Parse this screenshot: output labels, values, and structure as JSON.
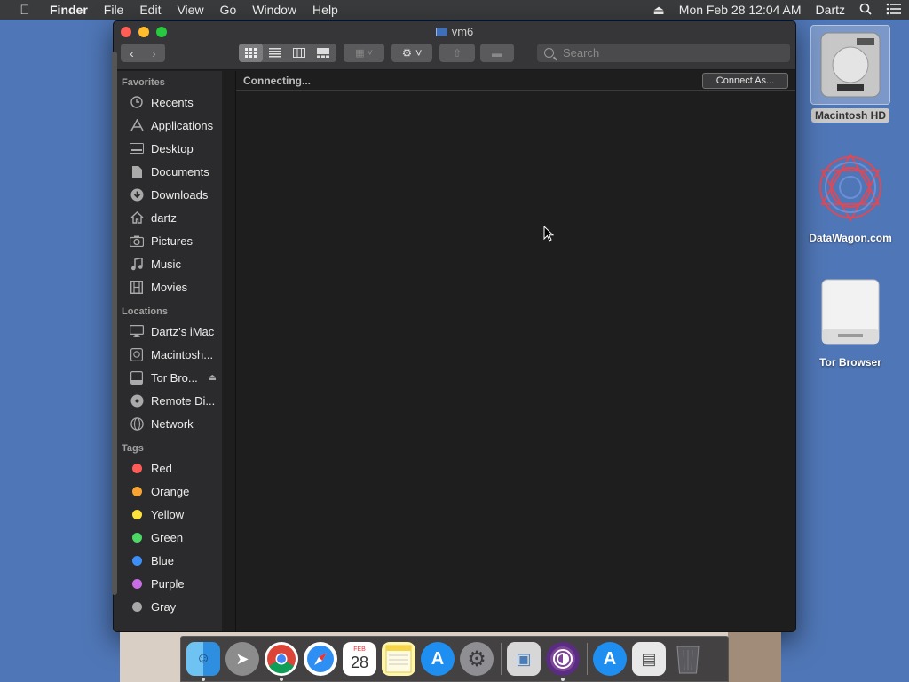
{
  "menubar": {
    "app": "Finder",
    "items": [
      "File",
      "Edit",
      "View",
      "Go",
      "Window",
      "Help"
    ],
    "clock": "Mon Feb 28  12:04 AM",
    "user": "Dartz"
  },
  "window": {
    "title": "vm6",
    "search_placeholder": "Search",
    "status": "Connecting...",
    "connect_button": "Connect As..."
  },
  "sidebar": {
    "favorites_header": "Favorites",
    "favorites": [
      {
        "label": "Recents",
        "icon": "clock-icon"
      },
      {
        "label": "Applications",
        "icon": "applications-icon"
      },
      {
        "label": "Desktop",
        "icon": "desktop-icon"
      },
      {
        "label": "Documents",
        "icon": "document-icon"
      },
      {
        "label": "Downloads",
        "icon": "download-icon"
      },
      {
        "label": "dartz",
        "icon": "home-icon"
      },
      {
        "label": "Pictures",
        "icon": "camera-icon"
      },
      {
        "label": "Music",
        "icon": "music-note-icon"
      },
      {
        "label": "Movies",
        "icon": "film-icon"
      }
    ],
    "locations_header": "Locations",
    "locations": [
      {
        "label": "Dartz’s iMac",
        "icon": "imac-icon"
      },
      {
        "label": "Macintosh...",
        "icon": "hard-disk-icon"
      },
      {
        "label": "Tor Bro...",
        "icon": "external-disk-icon"
      },
      {
        "label": "Remote Di...",
        "icon": "optical-disc-icon"
      },
      {
        "label": "Network",
        "icon": "globe-icon"
      }
    ],
    "tags_header": "Tags",
    "tags": [
      {
        "label": "Red",
        "color": "#ff5b57"
      },
      {
        "label": "Orange",
        "color": "#f8a433"
      },
      {
        "label": "Yellow",
        "color": "#fde23d"
      },
      {
        "label": "Green",
        "color": "#4cd964"
      },
      {
        "label": "Blue",
        "color": "#3d8ef7"
      },
      {
        "label": "Purple",
        "color": "#c86de6"
      },
      {
        "label": "Gray",
        "color": "#a8a8a8"
      }
    ]
  },
  "desktop": {
    "icons": [
      {
        "label": "Macintosh HD",
        "icon": "hard-disk-icon"
      },
      {
        "label": "DataWagon.com",
        "icon": "mandala-icon"
      },
      {
        "label": "Tor Browser",
        "icon": "external-disk-icon"
      }
    ]
  },
  "dock": {
    "calendar_month": "FEB",
    "calendar_day": "28"
  }
}
